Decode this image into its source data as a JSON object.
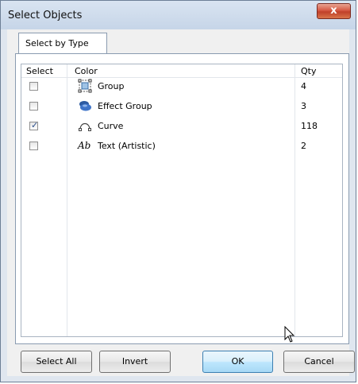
{
  "window": {
    "title": "Select Objects",
    "close_label": "x"
  },
  "tab": {
    "label": "Select by Type"
  },
  "list": {
    "columns": [
      "Select",
      "Color",
      "Qty"
    ],
    "rows": [
      {
        "label": "Group",
        "qty": "4",
        "checked": false,
        "icon": "group-icon"
      },
      {
        "label": "Effect Group",
        "qty": "3",
        "checked": false,
        "icon": "effect-group-icon"
      },
      {
        "label": "Curve",
        "qty": "118",
        "checked": true,
        "icon": "curve-icon"
      },
      {
        "label": "Text (Artistic)",
        "qty": "2",
        "checked": false,
        "icon": "artistic-text-icon",
        "icon_text": "Ab"
      }
    ]
  },
  "buttons": {
    "select_all": "Select All",
    "invert": "Invert",
    "ok": "OK",
    "cancel": "Cancel"
  },
  "colors": {
    "close_button": "#d65a44",
    "default_button_border": "#3c7fb1",
    "check_mark": "#2b4f8c"
  }
}
